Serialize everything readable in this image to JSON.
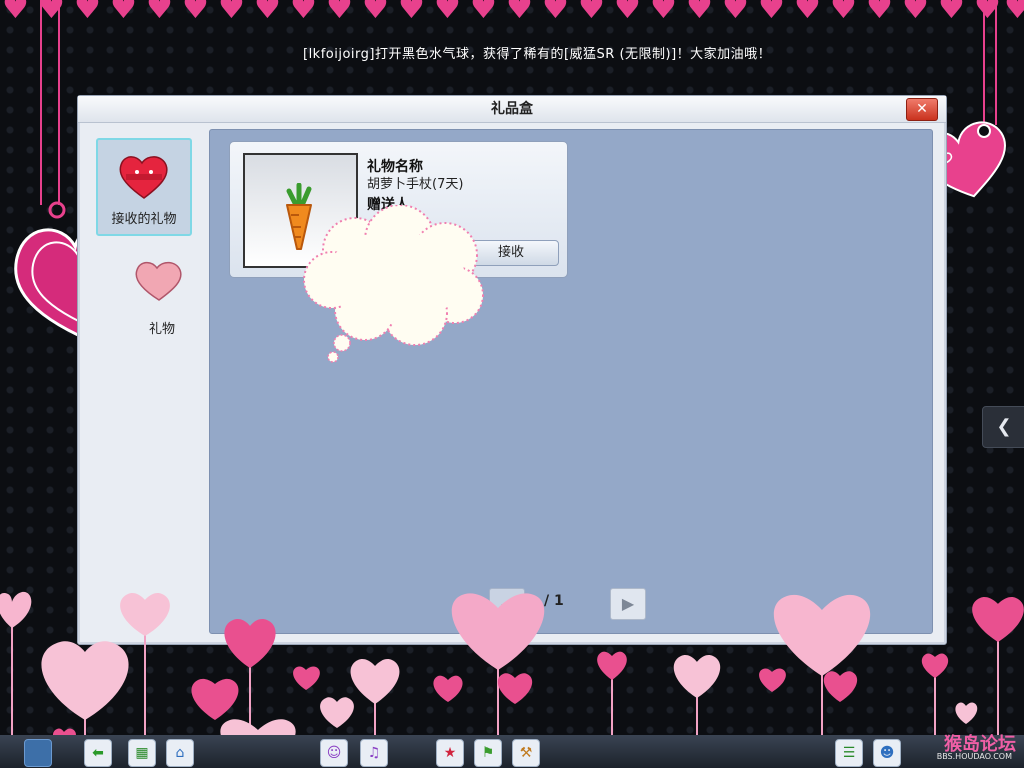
{
  "announcement": "[lkfoijoirg]打开黑色水气球，获得了稀有的[威猛SR (无限制)]！大家加油哦！",
  "window": {
    "title": "礼品盒",
    "close_icon": "close-icon"
  },
  "sidebar": {
    "items": [
      {
        "label": "接收的礼物",
        "icon": "heart-gift-icon",
        "active": true
      },
      {
        "label": "礼物",
        "icon": "heart-gift-icon",
        "active": false
      }
    ]
  },
  "gift": {
    "name_title": "礼物名称",
    "name_value": "胡萝卜手杖(7天)",
    "sender_title": "赠送人",
    "accept_label": "接收",
    "image_icon": "carrot-icon"
  },
  "pager": {
    "text": "/ 1"
  },
  "watermark": {
    "title": "猴岛论坛",
    "sub": "BBS.HOUDAO.COM"
  },
  "colors": {
    "accent_pink": "#e8418d",
    "panel_blue": "#94a8c8"
  }
}
